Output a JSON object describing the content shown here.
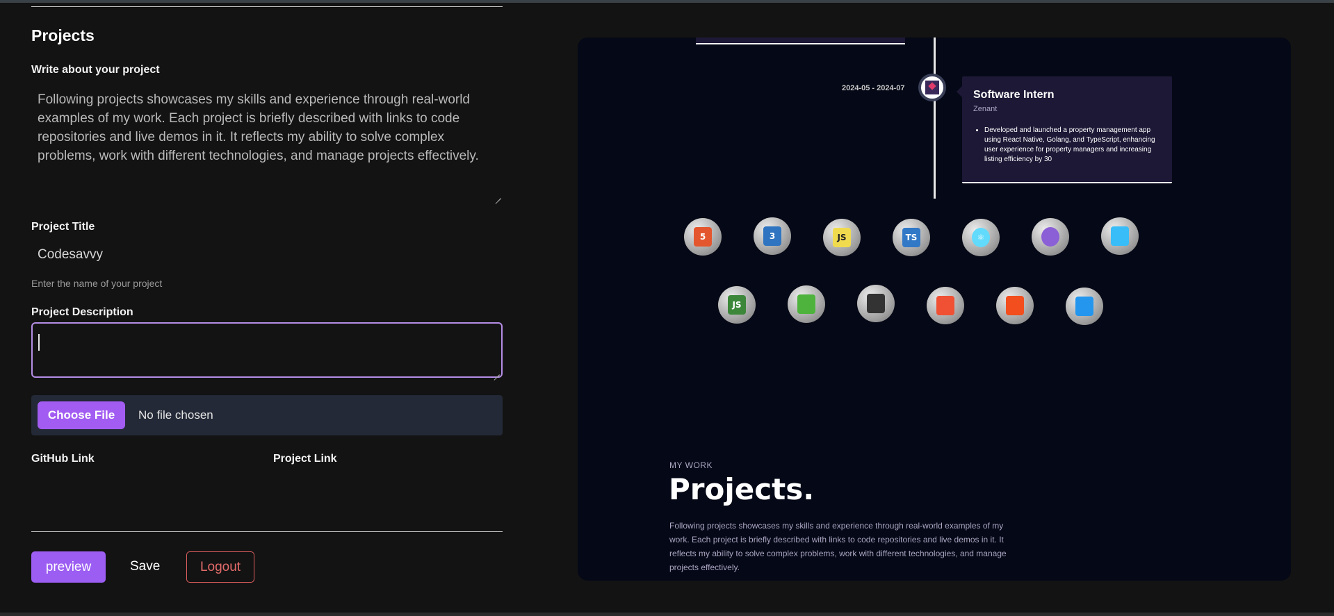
{
  "form": {
    "section_title": "Projects",
    "about_label": "Write about your project",
    "about_text": "Following projects showcases my skills and experience through real-world examples of my work. Each project is briefly described with links to code repositories and live demos in it. It reflects my ability to solve complex problems, work with different technologies, and manage projects effectively.",
    "project_title_label": "Project Title",
    "project_title_value": "Codesavvy",
    "project_title_help": "Enter the name of your project",
    "project_description_label": "Project Description",
    "project_description_value": "",
    "choose_file_label": "Choose File",
    "no_file_text": "No file chosen",
    "github_link_label": "GitHub Link",
    "project_link_label": "Project Link"
  },
  "actions": {
    "preview_label": "preview",
    "save_label": "Save",
    "logout_label": "Logout"
  },
  "preview": {
    "experience": {
      "date": "2024-05 - 2024-07",
      "title": "Software Intern",
      "company": "Zenant",
      "bullet": "Developed and launched a property management app using React Native, Golang, and TypeScript, enhancing user experience for property managers and increasing listing efficiency by 30"
    },
    "tech_icons": [
      {
        "name": "html5-icon",
        "label": "5",
        "color": "#e4572e"
      },
      {
        "name": "css3-icon",
        "label": "3",
        "color": "#2f74c0"
      },
      {
        "name": "javascript-icon",
        "label": "JS",
        "color": "#f0db4f"
      },
      {
        "name": "typescript-icon",
        "label": "TS",
        "color": "#3178c6"
      },
      {
        "name": "react-icon",
        "label": "⚛",
        "color": "#61dafb"
      },
      {
        "name": "redux-icon",
        "label": "",
        "color": "#8b5fd6"
      },
      {
        "name": "tailwind-icon",
        "label": "",
        "color": "#38bdf8"
      },
      {
        "name": "nodejs-icon",
        "label": "JS",
        "color": "#3c873a"
      },
      {
        "name": "mongodb-icon",
        "label": "",
        "color": "#4db33d"
      },
      {
        "name": "threejs-icon",
        "label": "",
        "color": "#333333"
      },
      {
        "name": "git-icon",
        "label": "",
        "color": "#f05033"
      },
      {
        "name": "figma-icon",
        "label": "",
        "color": "#f24e1e"
      },
      {
        "name": "docker-icon",
        "label": "",
        "color": "#2496ed"
      }
    ],
    "section_subtitle": "MY WORK",
    "section_heading": "Projects.",
    "section_description": "Following projects showcases my skills and experience through real-world examples of my work. Each project is briefly described with links to code repositories and live demos in it. It reflects my ability to solve complex problems, work with different technologies, and manage projects effectively."
  },
  "colors": {
    "accent": "#9c5df2",
    "logout": "#e25f5f",
    "preview_bg": "#050816",
    "card_bg": "#1d1836"
  }
}
